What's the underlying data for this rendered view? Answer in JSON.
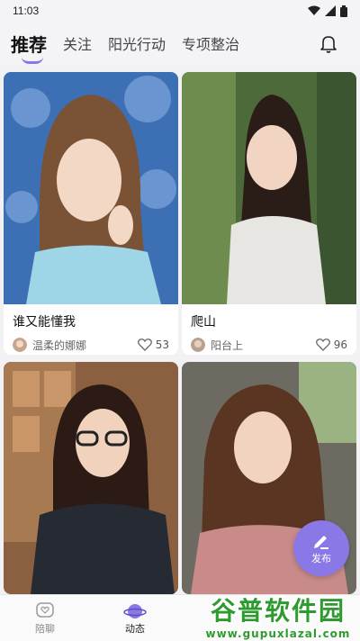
{
  "status_bar": {
    "time": "11:03"
  },
  "nav": {
    "tabs": [
      {
        "label": "推荐",
        "active": true
      },
      {
        "label": "关注"
      },
      {
        "label": "阳光行动"
      },
      {
        "label": "专项整治"
      }
    ],
    "accent": "#8a78e6"
  },
  "posts": [
    {
      "title": "谁又能懂我",
      "author": "温柔的娜娜",
      "likes": "53"
    },
    {
      "title": "爬山",
      "author": "阳台上",
      "likes": "96"
    },
    {
      "title": "",
      "author": "",
      "likes": ""
    },
    {
      "title": "",
      "author": "",
      "likes": ""
    }
  ],
  "fab": {
    "label": "发布"
  },
  "bottom_nav": {
    "items": [
      {
        "label": "陪聊",
        "icon": "heart-chat-icon"
      },
      {
        "label": "动态",
        "icon": "planet-icon",
        "active": true
      }
    ]
  },
  "watermark": {
    "title": "谷普软件园",
    "url": "www.gupuxlazal.com"
  }
}
